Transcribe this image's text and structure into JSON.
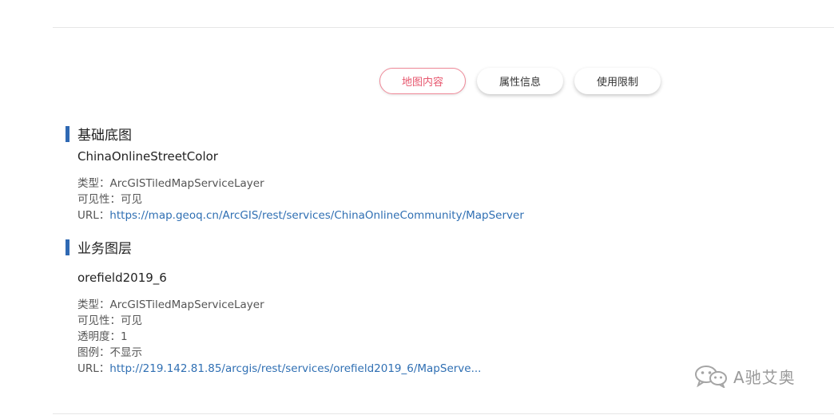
{
  "tabs": [
    {
      "label": "地图内容",
      "active": true
    },
    {
      "label": "属性信息",
      "active": false
    },
    {
      "label": "使用限制",
      "active": false
    }
  ],
  "sections": [
    {
      "title": "基础底图",
      "layer": {
        "name": "ChinaOnlineStreetColor",
        "type_label": "类型：",
        "type_value": "ArcGISTiledMapServiceLayer",
        "visibility_label": "可见性：",
        "visibility_value": "可见",
        "url_label": "URL：",
        "url_value": "https://map.geoq.cn/ArcGIS/rest/services/ChinaOnlineCommunity/MapServer"
      }
    },
    {
      "title": "业务图层",
      "layer": {
        "name": "orefield2019_6",
        "type_label": "类型：",
        "type_value": "ArcGISTiledMapServiceLayer",
        "visibility_label": "可见性：",
        "visibility_value": "可见",
        "opacity_label": "透明度：",
        "opacity_value": "1",
        "legend_label": "图例：",
        "legend_value": "不显示",
        "url_label": "URL：",
        "url_value": "http://219.142.81.85/arcgis/rest/services/orefield2019_6/MapServe..."
      }
    }
  ],
  "watermark": {
    "text": "A驰艾奥",
    "icon": "wechat-icon"
  },
  "colors": {
    "accent": "#2f69b3",
    "active_tab": "#e7576e",
    "link": "#2f6fb3"
  }
}
